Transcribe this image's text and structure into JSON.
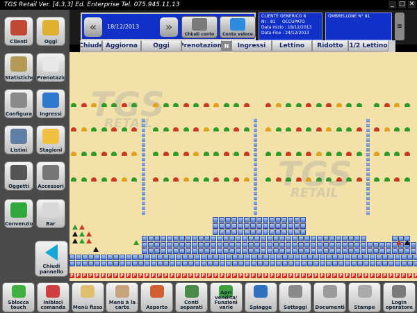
{
  "window": {
    "title": "TGS Retail Ver. [4.3.3] Ed. Enterprise   Tel. 075.945.11.13",
    "minimize": "_",
    "maximize": "□",
    "close": "✕"
  },
  "sidebar": {
    "items": [
      {
        "label": "Clienti",
        "icon": "clients-icon",
        "color": "#c04a35"
      },
      {
        "label": "Oggi",
        "icon": "beach-umbrella-icon",
        "color": "#e0b030"
      },
      {
        "label": "Statistiche",
        "icon": "statistics-icon",
        "color": "#b59a55"
      },
      {
        "label": "Prenotazioni",
        "icon": "calendar-icon",
        "color": "#e8e8e8"
      },
      {
        "label": "Configura",
        "icon": "gear-icon",
        "color": "#8a8a8a"
      },
      {
        "label": "Ingressi",
        "icon": "ticket-icon",
        "color": "#2f78d0"
      },
      {
        "label": "Listini",
        "icon": "price-list-icon",
        "color": "#5e7fa6"
      },
      {
        "label": "Stagioni",
        "icon": "weather-icon",
        "color": "#f0c040"
      },
      {
        "label": "Oggetti",
        "icon": "objects-icon",
        "color": "#555555"
      },
      {
        "label": "Accessori",
        "icon": "accessories-icon",
        "color": "#777777"
      },
      {
        "label": "Convenzioni",
        "icon": "exchange-icon",
        "color": "#2faa3a"
      },
      {
        "label": "Bar",
        "icon": "coffee-icon",
        "color": "#d8d8d8"
      }
    ],
    "close_panel": "Chiudi pannello"
  },
  "header": {
    "prev": "«",
    "next": "»",
    "date": "18/12/2013",
    "close_account": "Chiudi conto",
    "quick_account": "Conto veloce",
    "client": {
      "name": "CLIENTE GENERICO 8",
      "nr_label": "Nr :",
      "nr_value": "81",
      "status": "OCCUPATO",
      "start_label": "Data Inizio :",
      "start_value": "18/12/2013",
      "end_label": "Data Fine :",
      "end_value": "24/12/2013"
    },
    "umbrella": "OMBRELLONE N° 81"
  },
  "tabs": [
    {
      "label": "Chiude",
      "w": 32
    },
    {
      "label": "Aggiorna",
      "w": 56
    },
    {
      "label": "Oggi",
      "w": 58
    },
    {
      "label": "Prenotazioni",
      "w": 58
    },
    {
      "label": "N",
      "w": 14,
      "box": true
    },
    {
      "label": "Ingressi",
      "w": 58
    },
    {
      "label": "Lettino",
      "w": 58
    },
    {
      "label": "Ridotto",
      "w": 52
    },
    {
      "label": "1/2 Lettino",
      "w": 58
    }
  ],
  "beach": {
    "watermark1": "TGS",
    "watermark2": "RETAIL",
    "reserved_mark": "P"
  },
  "bottom": {
    "buttons": [
      {
        "label": "Sblocca touch",
        "icon": "lock-icon",
        "color": "#3faf40"
      },
      {
        "label": "Inibisci comanda",
        "icon": "printer-icon",
        "color": "#d04040"
      },
      {
        "label": "Menù fisso",
        "icon": "chef-icon",
        "color": "#e0c070"
      },
      {
        "label": "Menù à la carte",
        "icon": "waiter-icon",
        "color": "#c7a27a"
      },
      {
        "label": "Asporto",
        "icon": "pizza-icon",
        "color": "#d06030"
      },
      {
        "label": "Conti separati",
        "icon": "split-bill-icon",
        "color": "#4a8a4a"
      },
      {
        "label": "Apri vendita/ Funzioni varie",
        "icon": "sale-icon",
        "color": "#3da03d"
      },
      {
        "label": "Spiagge",
        "icon": "globe-icon",
        "color": "#3070c0"
      },
      {
        "label": "Settaggi",
        "icon": "settings-icon",
        "color": "#8a8a8a"
      },
      {
        "label": "Documenti",
        "icon": "documents-icon",
        "color": "#9a9a9a"
      },
      {
        "label": "Stampe",
        "icon": "print-icon",
        "color": "#aaaaaa"
      },
      {
        "label": "Login operatore",
        "icon": "user-icon",
        "color": "#7a7a7a"
      }
    ]
  }
}
